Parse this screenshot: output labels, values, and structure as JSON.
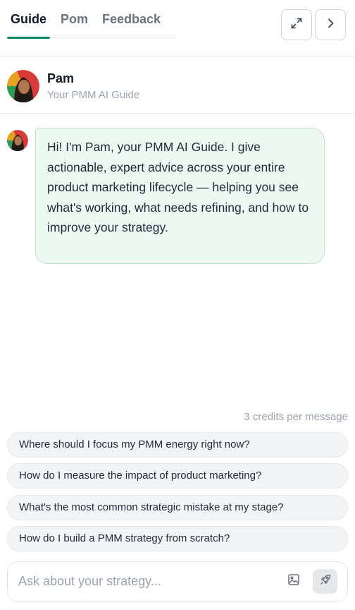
{
  "tabs": [
    {
      "label": "Guide",
      "active": true
    },
    {
      "label": "Pom",
      "active": false
    },
    {
      "label": "Feedback",
      "active": false
    }
  ],
  "toolbar": {
    "expand_icon": "expand-arrows-icon",
    "next_icon": "chevron-right-icon"
  },
  "assistant": {
    "name": "Pam",
    "role": "Your PMM AI Guide"
  },
  "messages": [
    {
      "sender": "assistant",
      "text": "Hi! I'm Pam, your PMM AI Guide. I give actionable, expert advice across your entire product marketing lifecycle — helping you see what's working, what needs refining, and how to improve your strategy."
    }
  ],
  "credits_note": "3 credits per message",
  "suggestions": [
    "Where should I focus my PMM energy right now?",
    "How do I measure the impact of product marketing?",
    "What's the most common strategic mistake at my stage?",
    "How do I build a PMM strategy from scratch?"
  ],
  "composer": {
    "placeholder": "Ask about your strategy...",
    "value": "",
    "attach_icon": "image-icon",
    "send_icon": "rocket-icon"
  },
  "colors": {
    "accent": "#0f8a5f",
    "bubble_bg": "#eef8f3",
    "bubble_border": "#bfe3d1",
    "muted_text": "#9ca3af"
  }
}
